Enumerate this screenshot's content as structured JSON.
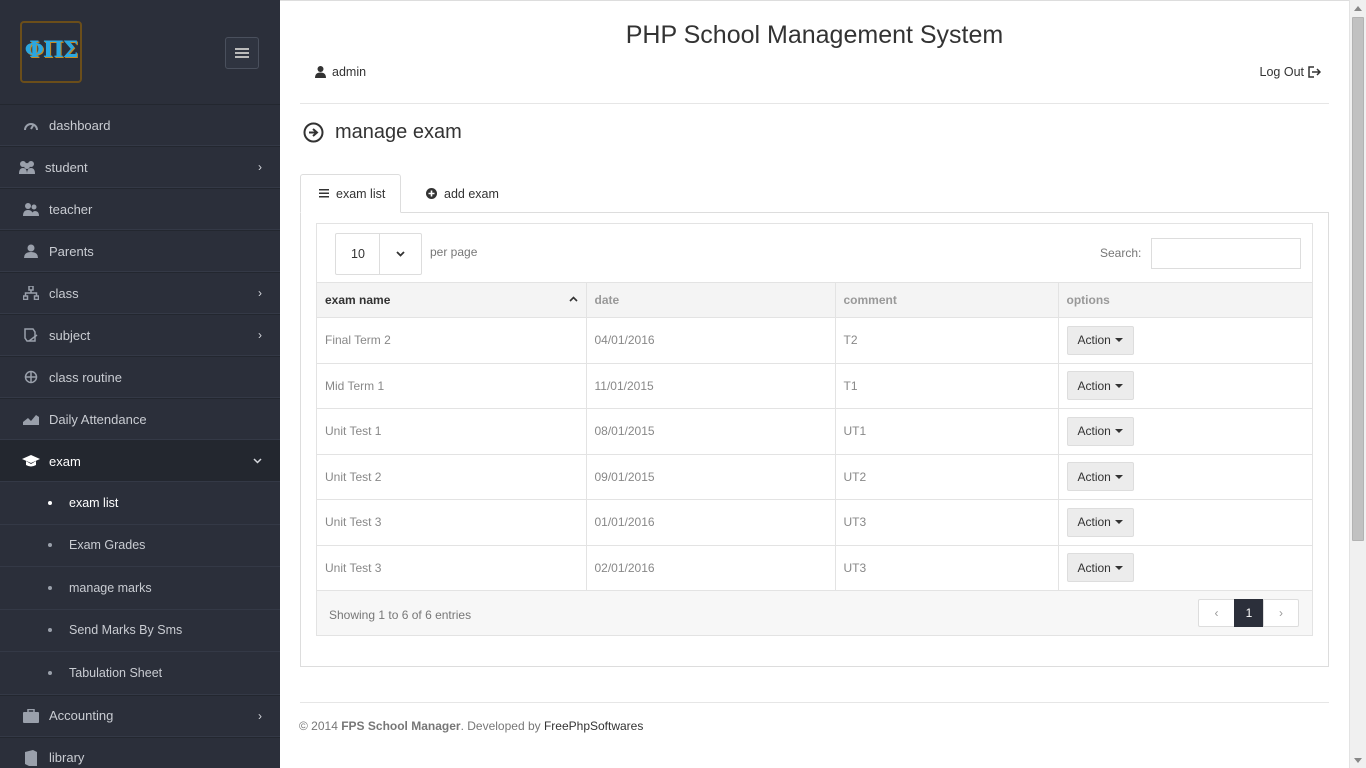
{
  "app": {
    "title": "PHP School Management System"
  },
  "user": {
    "name": "admin",
    "logout_label": "Log Out"
  },
  "sidebar": {
    "logo_text": "ΦΠΣ",
    "items": [
      {
        "label": "dashboard",
        "icon": "dashboard-icon",
        "has_children": false
      },
      {
        "label": "student",
        "icon": "users-icon",
        "has_children": true
      },
      {
        "label": "teacher",
        "icon": "teacher-icon",
        "has_children": false
      },
      {
        "label": "Parents",
        "icon": "user-icon",
        "has_children": false
      },
      {
        "label": "class",
        "icon": "sitemap-icon",
        "has_children": true
      },
      {
        "label": "subject",
        "icon": "book-icon",
        "has_children": true
      },
      {
        "label": "class routine",
        "icon": "crosshair-icon",
        "has_children": false
      },
      {
        "label": "Daily Attendance",
        "icon": "area-chart-icon",
        "has_children": false
      },
      {
        "label": "exam",
        "icon": "graduation-cap-icon",
        "has_children": true,
        "expanded": true
      },
      {
        "label": "Accounting",
        "icon": "briefcase-icon",
        "has_children": true
      },
      {
        "label": "library",
        "icon": "library-book-icon",
        "has_children": false
      }
    ],
    "exam_subitems": [
      "exam list",
      "Exam Grades",
      "manage marks",
      "Send Marks By Sms",
      "Tabulation Sheet"
    ]
  },
  "page": {
    "heading": "manage exam"
  },
  "tabs": {
    "list": "exam list",
    "add": "add exam"
  },
  "table_controls": {
    "per_page_value": "10",
    "per_page_label": "per page",
    "search_label": "Search:",
    "search_value": ""
  },
  "table": {
    "columns": [
      "exam name",
      "date",
      "comment",
      "options"
    ],
    "rows": [
      {
        "name": "Final Term 2",
        "date": "04/01/2016",
        "comment": "T2",
        "action": "Action"
      },
      {
        "name": "Mid Term 1",
        "date": "11/01/2015",
        "comment": "T1",
        "action": "Action"
      },
      {
        "name": "Unit Test 1",
        "date": "08/01/2015",
        "comment": "UT1",
        "action": "Action"
      },
      {
        "name": "Unit Test 2",
        "date": "09/01/2015",
        "comment": "UT2",
        "action": "Action"
      },
      {
        "name": "Unit Test 3",
        "date": "01/01/2016",
        "comment": "UT3",
        "action": "Action"
      },
      {
        "name": "Unit Test 3",
        "date": "02/01/2016",
        "comment": "UT3",
        "action": "Action"
      }
    ],
    "info": "Showing 1 to 6 of 6 entries",
    "pagination": {
      "prev": "‹",
      "current": "1",
      "next": "›"
    }
  },
  "footer": {
    "copyright": "© 2014 ",
    "brand": "FPS School Manager",
    "developed_by": ". Developed by ",
    "developer": "FreePhpSoftwares"
  },
  "colors": {
    "sidebar_bg": "#2b2f3a",
    "active_page_bg": "#2b2f3a"
  }
}
